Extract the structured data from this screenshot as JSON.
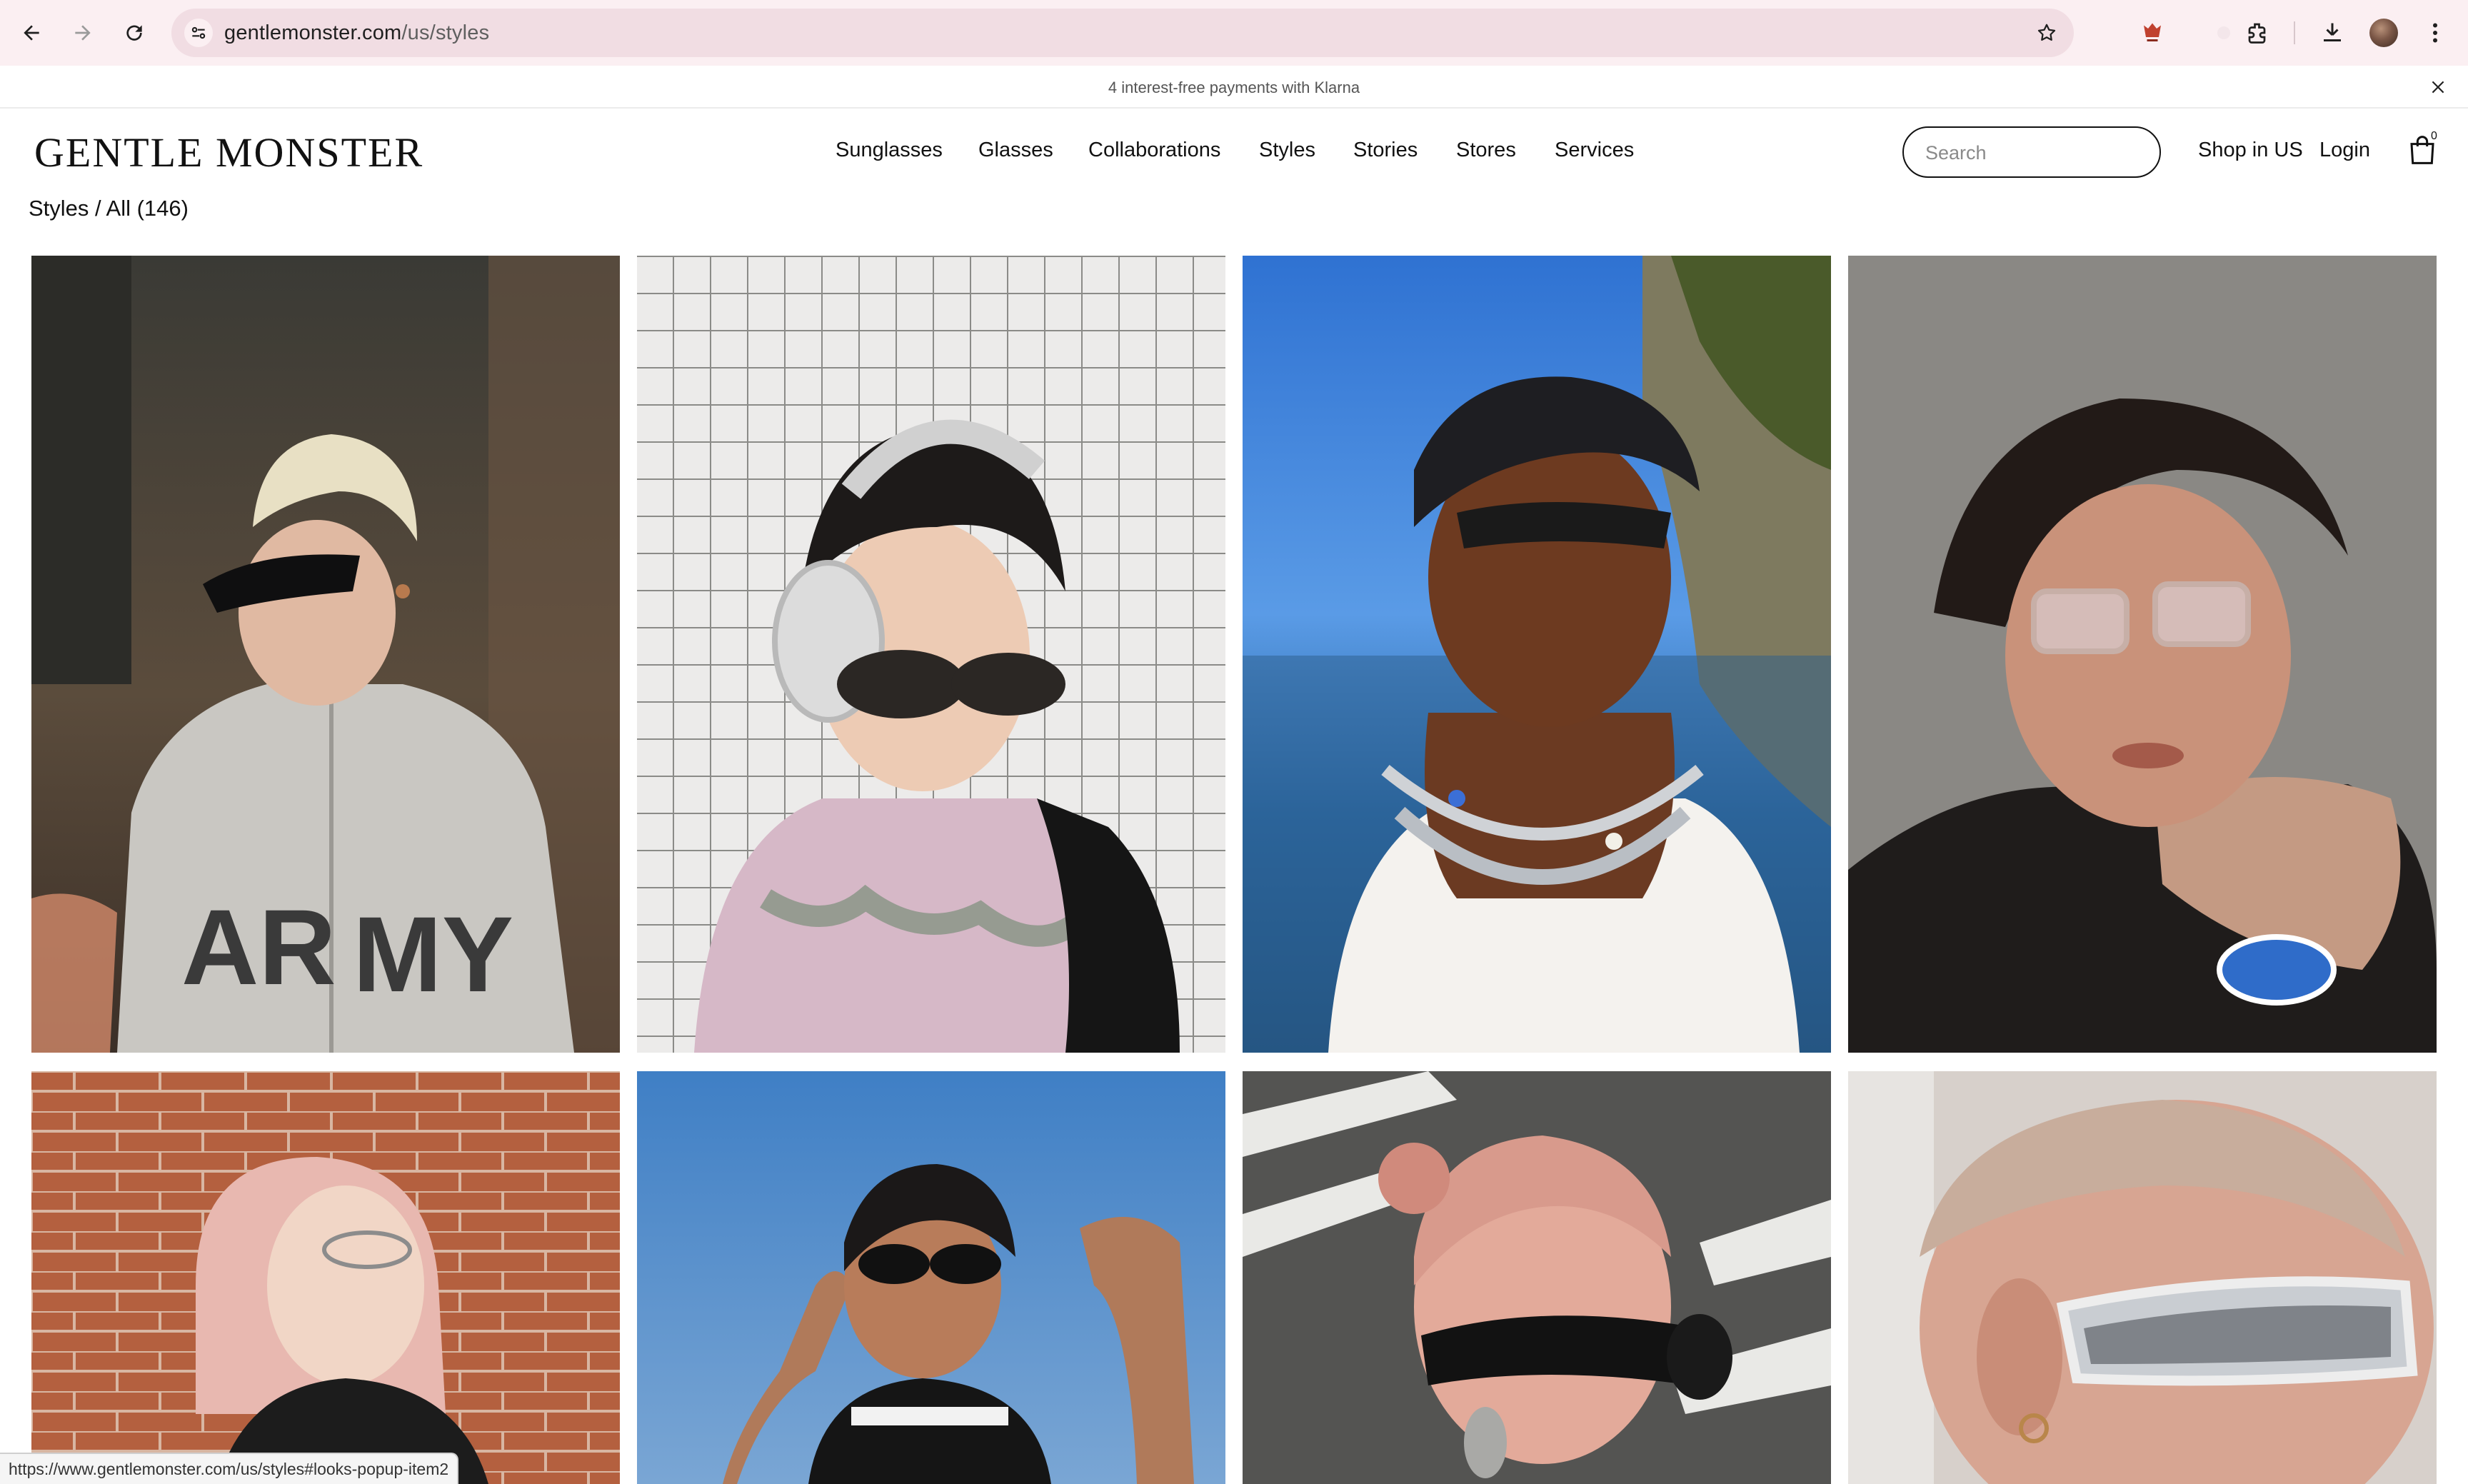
{
  "browser": {
    "url_host": "gentlemonster.com",
    "url_path": "/us/styles",
    "icons": [
      "back-arrow-icon",
      "forward-arrow-icon",
      "reload-icon",
      "site-settings-icon",
      "bookmark-star-icon",
      "extension-icon",
      "puzzle-extensions-icon",
      "download-icon",
      "profile-avatar",
      "more-vert-icon"
    ]
  },
  "promo": {
    "text": "4 interest-free payments with Klarna"
  },
  "header": {
    "logo": "GENTLE MONSTER",
    "nav": [
      "Sunglasses",
      "Glasses",
      "Collaborations",
      "Styles",
      "Stories",
      "Stores",
      "Services"
    ],
    "search_placeholder": "Search",
    "shop_in": "Shop in US",
    "login": "Login",
    "bag_count": "0"
  },
  "breadcrumb": "Styles / All (146)",
  "grid": {
    "columns": 4,
    "photos": [
      {
        "subject": "person-grey-army-hoodie-black-sunglasses",
        "bg": "#4a4a3e"
      },
      {
        "subject": "person-headphones-pink-tank-sunglasses",
        "bg": "#c9c9c6"
      },
      {
        "subject": "man-headscarf-chains-sea-sunglasses",
        "bg": "#3b7fd0"
      },
      {
        "subject": "woman-silver-glasses-leather-jacket",
        "bg": "#8e8c88"
      },
      {
        "subject": "person-pink-bob-glasses-brick-wall",
        "bg": "#b3603f"
      },
      {
        "subject": "woman-black-sunglasses-blue-sky",
        "bg": "#5d8fc8"
      },
      {
        "subject": "person-pink-bun-black-goggles-street",
        "bg": "#5a5a58"
      },
      {
        "subject": "person-buzzcut-silver-visor",
        "bg": "#cfc6c0"
      }
    ]
  },
  "status_bar": {
    "url": "https://www.gentlemonster.com/us/styles#looks-popup-item2"
  }
}
